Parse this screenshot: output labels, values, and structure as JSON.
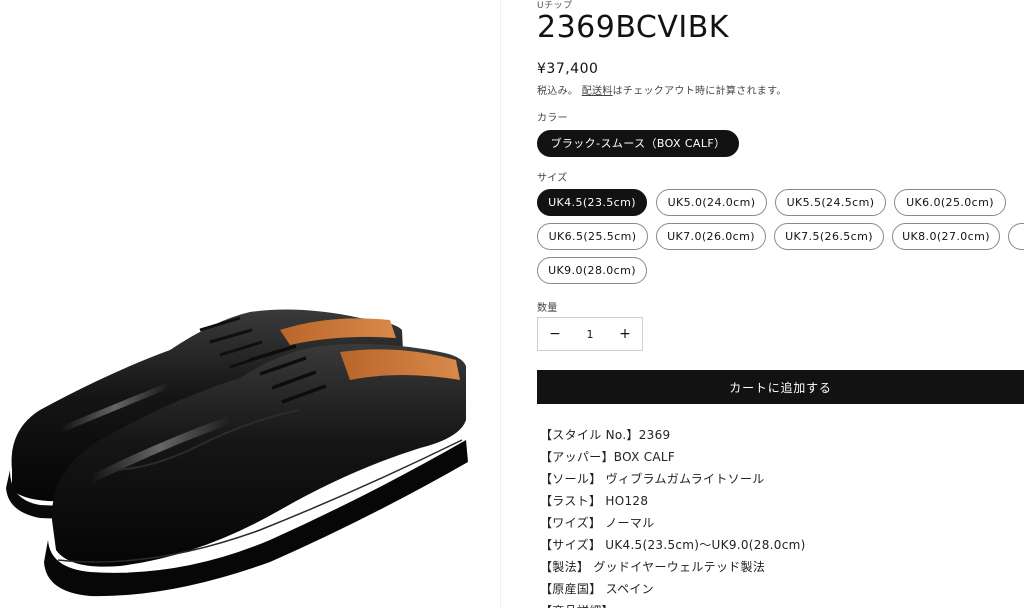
{
  "product": {
    "subtitle": "Uチップ",
    "title": "2369BCVIBK",
    "price": "¥37,400",
    "tax_prefix": "税込み。",
    "tax_link": "配送料",
    "tax_suffix": "はチェックアウト時に計算されます。"
  },
  "color": {
    "label": "カラー",
    "options": [
      "ブラック-スムース（BOX CALF）"
    ],
    "selected": "ブラック-スムース（BOX CALF）"
  },
  "size": {
    "label": "サイズ",
    "options": [
      "UK4.5(23.5cm)",
      "UK5.0(24.0cm)",
      "UK5.5(24.5cm)",
      "UK6.0(25.0cm)",
      "UK6.5(25.5cm)",
      "UK7.0(26.0cm)",
      "UK7.5(26.5cm)",
      "UK8.0(27.0cm)",
      "UK9.0(28.0cm)"
    ],
    "selected": "UK4.5(23.5cm)"
  },
  "quantity": {
    "label": "数量",
    "minus": "−",
    "value": "1",
    "plus": "+"
  },
  "cart": {
    "add_label": "カートに追加する"
  },
  "specs": [
    "【スタイル No.】2369",
    "【アッパー】BOX CALF",
    "【ソール】 ヴィブラムガムライトソール",
    "【ラスト】 HO128",
    "【ワイズ】 ノーマル",
    "【サイズ】 UK4.5(23.5cm)〜UK9.0(28.0cm)",
    "【製法】 グッドイヤーウェルテッド製法",
    "【原産国】 スペイン",
    "【商品詳細】"
  ],
  "image": {
    "icon": "shoe-image"
  }
}
